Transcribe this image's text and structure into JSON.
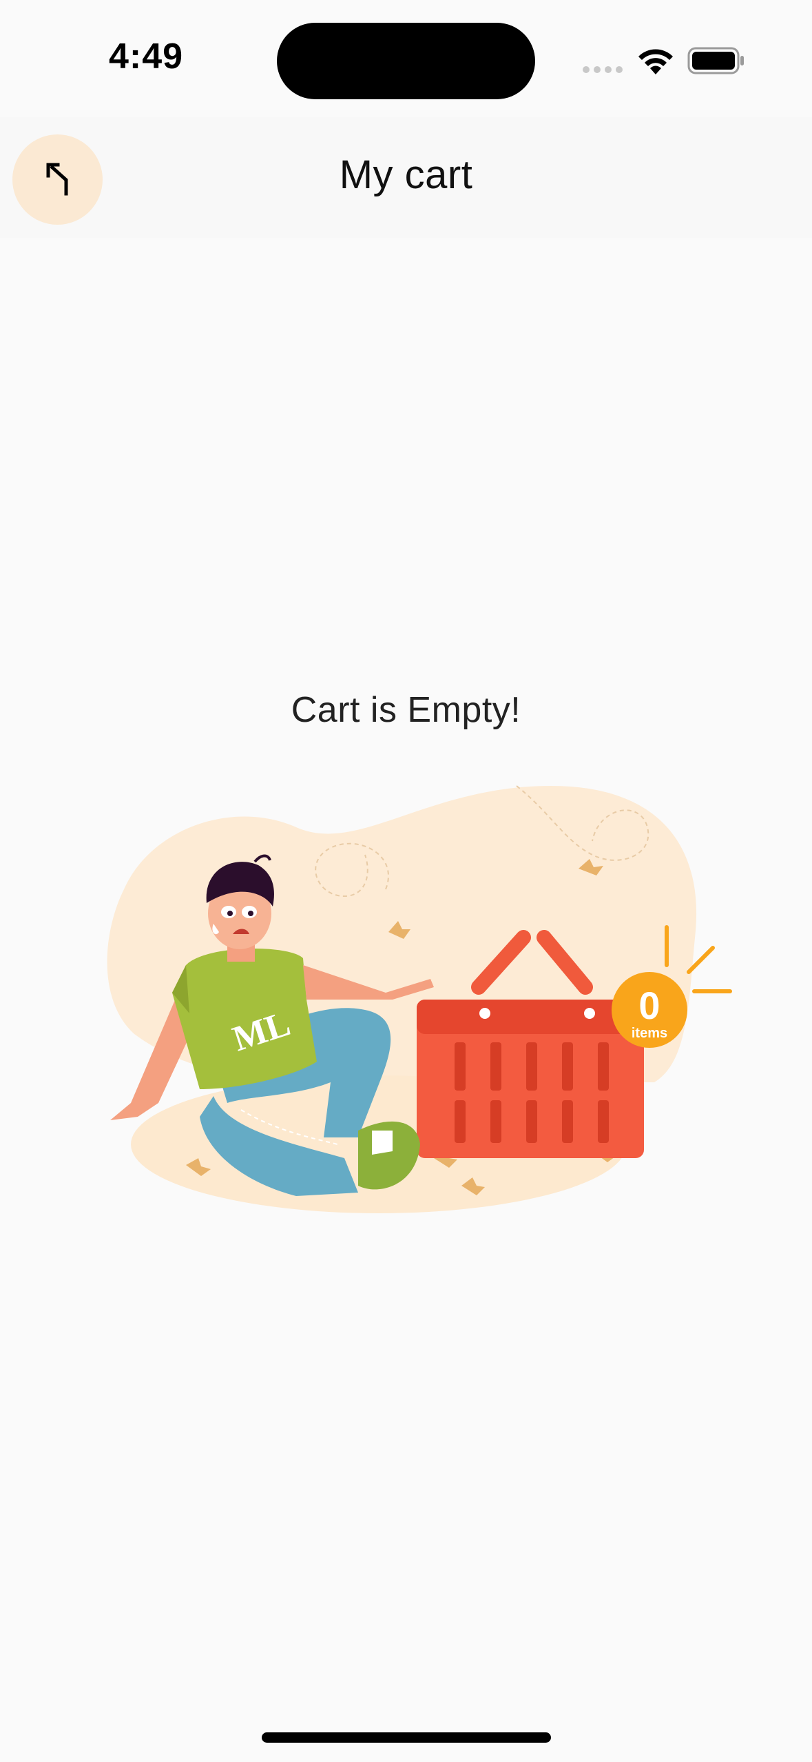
{
  "status_bar": {
    "time": "4:49"
  },
  "header": {
    "title": "My cart",
    "back_icon": "arrow-up-left-icon"
  },
  "main": {
    "empty_message": "Cart is Empty!",
    "illustration": {
      "badge_count": "0",
      "badge_label": "items",
      "shirt_text": "ML"
    }
  },
  "colors": {
    "background": "#FAFAFA",
    "back_button_bg": "#FBE9D3",
    "basket": "#F2593E",
    "badge": "#F9A51B",
    "blob": "#FDEBD5"
  }
}
